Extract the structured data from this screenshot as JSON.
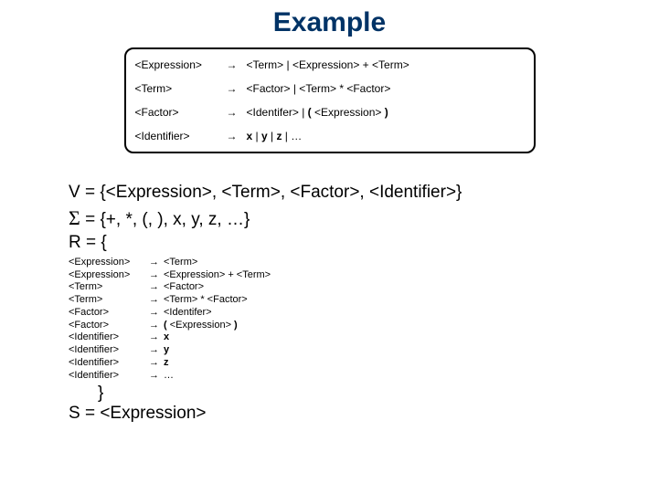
{
  "title": "Example",
  "grammar": {
    "rows": [
      {
        "lhs": "<Expression>",
        "arrow": "→",
        "rhs_html": "<Term> | <Expression> + <Term>"
      },
      {
        "lhs": "<Term>",
        "arrow": "→",
        "rhs_html": "<Factor> | <Term> * <Factor>"
      },
      {
        "lhs": "<Factor>",
        "arrow": "→",
        "rhs_html": "<Identifer> | <b>(</b> <Expression> <b>)</b>"
      },
      {
        "lhs": "<Identifier>",
        "arrow": "→",
        "rhs_html": "<b>x</b> | <b>y</b> | <b>z</b> | …"
      }
    ]
  },
  "defs": {
    "V": "V = {<Expression>, <Term>, <Factor>, <Identifier>}",
    "Sigma_prefix": "Σ",
    "Sigma_rest": " = {+, *, (, ), x, y, z, …}",
    "R_prefix": "R = {"
  },
  "rules": [
    {
      "lhs": "<Expression>",
      "arr": "→",
      "rhs_html": "<Term>"
    },
    {
      "lhs": "<Expression>",
      "arr": "→",
      "rhs_html": "<Expression> + <Term>"
    },
    {
      "lhs": "<Term>",
      "arr": "→",
      "rhs_html": "<Factor>"
    },
    {
      "lhs": "<Term>",
      "arr": "→",
      "rhs_html": "<Term> * <Factor>"
    },
    {
      "lhs": "<Factor>",
      "arr": "→",
      "rhs_html": "<Identifer>"
    },
    {
      "lhs": "<Factor>",
      "arr": "→",
      "rhs_html": "<b>(</b> <Expression> <b>)</b>"
    },
    {
      "lhs": "<Identifier>",
      "arr": "→",
      "rhs_html": "<b>x</b>"
    },
    {
      "lhs": "<Identifier>",
      "arr": "→",
      "rhs_html": "<b>y</b>"
    },
    {
      "lhs": "<Identifier>",
      "arr": "→",
      "rhs_html": "<b>z</b>"
    },
    {
      "lhs": "<Identifier>",
      "arr": "→",
      "rhs_html": "…"
    }
  ],
  "closing": "}",
  "start": "S = <Expression>"
}
